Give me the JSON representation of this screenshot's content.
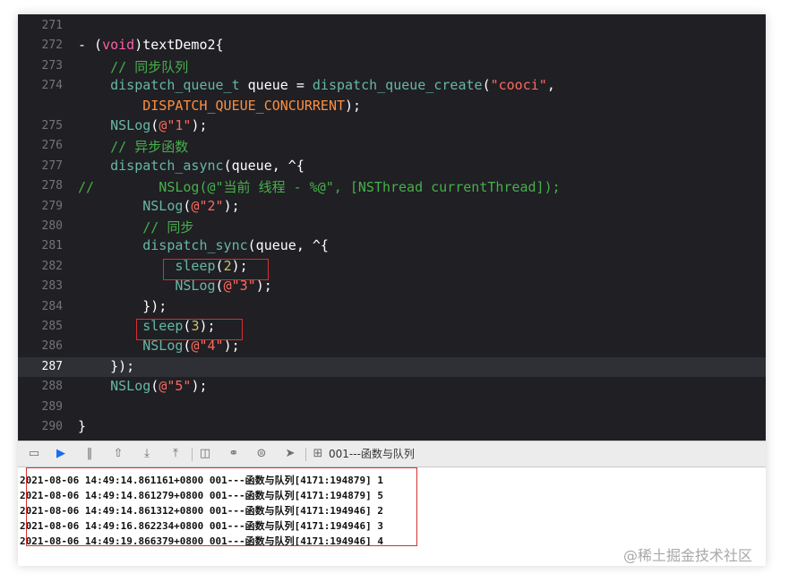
{
  "editor": {
    "lines": [
      {
        "num": "271",
        "tokens": []
      },
      {
        "num": "272",
        "tokens": [
          [
            "",
            "- ("
          ],
          [
            "kw",
            "void"
          ],
          [
            "",
            ")textDemo2{"
          ]
        ]
      },
      {
        "num": "273",
        "tokens": [
          [
            "zh-cm",
            "    // 同步队列"
          ]
        ]
      },
      {
        "num": "274",
        "tokens": [
          [
            "fn",
            "    dispatch_queue_t"
          ],
          [
            "",
            " queue = "
          ],
          [
            "fn",
            "dispatch_queue_create"
          ],
          [
            "",
            "("
          ],
          [
            "str",
            "\"cooci\""
          ],
          [
            "",
            ","
          ]
        ]
      },
      {
        "num": "",
        "tokens": [
          [
            "mac",
            "        DISPATCH_QUEUE_CONCURRENT"
          ],
          [
            "",
            ");"
          ]
        ]
      },
      {
        "num": "275",
        "tokens": [
          [
            "fn",
            "    NSLog"
          ],
          [
            "",
            "("
          ],
          [
            "str",
            "@\"1\""
          ],
          [
            "",
            ");"
          ]
        ]
      },
      {
        "num": "276",
        "tokens": [
          [
            "zh-cm",
            "    // 异步函数"
          ]
        ]
      },
      {
        "num": "277",
        "tokens": [
          [
            "fn",
            "    dispatch_async"
          ],
          [
            "",
            "(queue, ^{"
          ]
        ]
      },
      {
        "num": "278",
        "tokens": [
          [
            "zh-cm",
            "//        NSLog(@\"当前 线程 - %@\", [NSThread currentThread]);"
          ]
        ]
      },
      {
        "num": "279",
        "tokens": [
          [
            "fn",
            "        NSLog"
          ],
          [
            "",
            "("
          ],
          [
            "str",
            "@\"2\""
          ],
          [
            "",
            ");"
          ]
        ]
      },
      {
        "num": "280",
        "tokens": [
          [
            "zh-cm",
            "        // 同步"
          ]
        ]
      },
      {
        "num": "281",
        "tokens": [
          [
            "fn",
            "        dispatch_sync"
          ],
          [
            "",
            "(queue, ^{"
          ]
        ]
      },
      {
        "num": "282",
        "tokens": [
          [
            "fn",
            "            sleep"
          ],
          [
            "",
            "("
          ],
          [
            "num",
            "2"
          ],
          [
            "",
            ");"
          ]
        ]
      },
      {
        "num": "283",
        "tokens": [
          [
            "fn",
            "            NSLog"
          ],
          [
            "",
            "("
          ],
          [
            "str",
            "@\"3\""
          ],
          [
            "",
            ");"
          ]
        ]
      },
      {
        "num": "284",
        "tokens": [
          [
            "",
            "        });"
          ]
        ]
      },
      {
        "num": "285",
        "tokens": [
          [
            "fn",
            "        sleep"
          ],
          [
            "",
            "("
          ],
          [
            "num",
            "3"
          ],
          [
            "",
            ");"
          ]
        ]
      },
      {
        "num": "286",
        "tokens": [
          [
            "fn",
            "        NSLog"
          ],
          [
            "",
            "("
          ],
          [
            "str",
            "@\"4\""
          ],
          [
            "",
            ");"
          ]
        ]
      },
      {
        "num": "287",
        "tokens": [
          [
            "",
            "    });"
          ]
        ],
        "current": true
      },
      {
        "num": "288",
        "tokens": [
          [
            "fn",
            "    NSLog"
          ],
          [
            "",
            "("
          ],
          [
            "str",
            "@\"5\""
          ],
          [
            "",
            ");"
          ]
        ]
      },
      {
        "num": "289",
        "tokens": []
      },
      {
        "num": "290",
        "tokens": [
          [
            "",
            "}"
          ]
        ]
      }
    ]
  },
  "toolbar": {
    "icons": [
      "hide-console-icon",
      "breakpoint-icon",
      "pause-icon",
      "step-over-icon",
      "step-in-icon",
      "step-out-icon",
      "view-hierarchy-icon",
      "memory-graph-icon",
      "environment-icon",
      "location-icon",
      "target-icon"
    ],
    "breadcrumb": "001---函数与队列"
  },
  "console": {
    "lines": [
      "2021-08-06 14:49:14.861161+0800 001---函数与队列[4171:194879] 1",
      "2021-08-06 14:49:14.861279+0800 001---函数与队列[4171:194879] 5",
      "2021-08-06 14:49:14.861312+0800 001---函数与队列[4171:194946] 2",
      "2021-08-06 14:49:16.862234+0800 001---函数与队列[4171:194946] 3",
      "2021-08-06 14:49:19.866379+0800 001---函数与队列[4171:194946] 4"
    ]
  },
  "watermark": "@稀土掘金技术社区",
  "colors": {
    "editor_bg": "#1f1f24",
    "keyword": "#fc5fa3",
    "function": "#67b7a4",
    "string": "#fc6a5d",
    "number": "#d0bf69",
    "comment": "#47b04a",
    "macro": "#fd8f3f",
    "annotation": "#d63131"
  }
}
